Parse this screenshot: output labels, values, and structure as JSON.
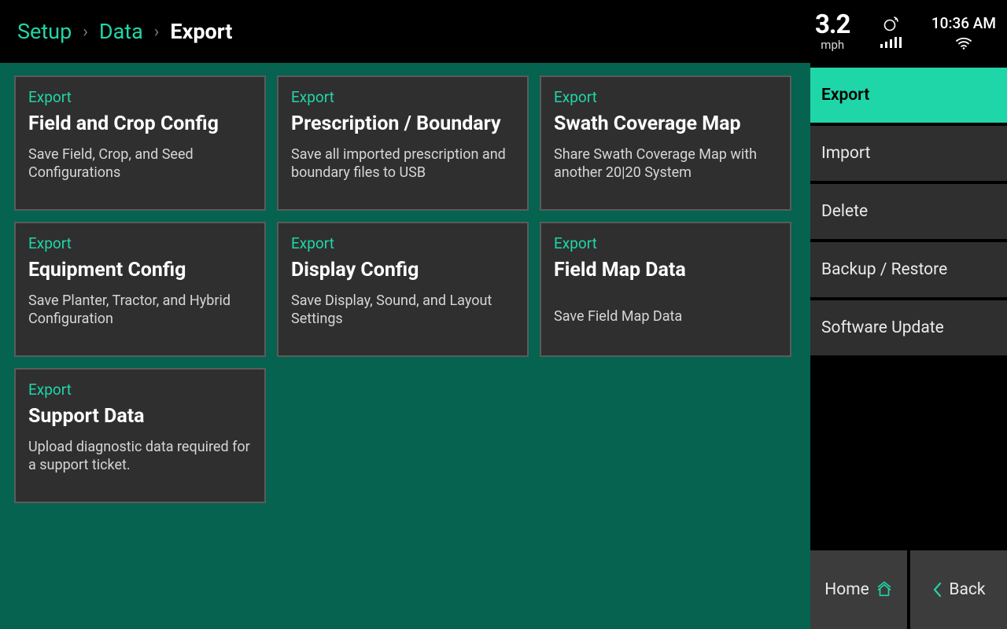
{
  "breadcrumb": {
    "items": [
      "Setup",
      "Data"
    ],
    "current": "Export"
  },
  "status": {
    "speed_value": "3.2",
    "speed_unit": "mph",
    "time": "10:36 AM"
  },
  "cards": [
    {
      "category": "Export",
      "title": "Field and Crop Config",
      "desc": "Save Field, Crop, and Seed Configurations"
    },
    {
      "category": "Export",
      "title": "Prescription / Boundary",
      "desc": "Save all imported prescription and boundary files to USB"
    },
    {
      "category": "Export",
      "title": "Swath Coverage Map",
      "desc": "Share Swath Coverage Map with another 20|20 System"
    },
    {
      "category": "Export",
      "title": "Equipment Config",
      "desc": "Save Planter, Tractor, and Hybrid Configuration"
    },
    {
      "category": "Export",
      "title": "Display Config",
      "desc": "Save Display, Sound, and Layout Settings"
    },
    {
      "category": "Export",
      "title": "Field Map Data",
      "desc": "Save Field Map Data"
    },
    {
      "category": "Export",
      "title": "Support Data",
      "desc": "Upload diagnostic data required for a support ticket."
    }
  ],
  "rail": {
    "items": [
      "Export",
      "Import",
      "Delete",
      "Backup / Restore",
      "Software Update"
    ],
    "active_index": 0
  },
  "footer": {
    "home": "Home",
    "back": "Back"
  }
}
